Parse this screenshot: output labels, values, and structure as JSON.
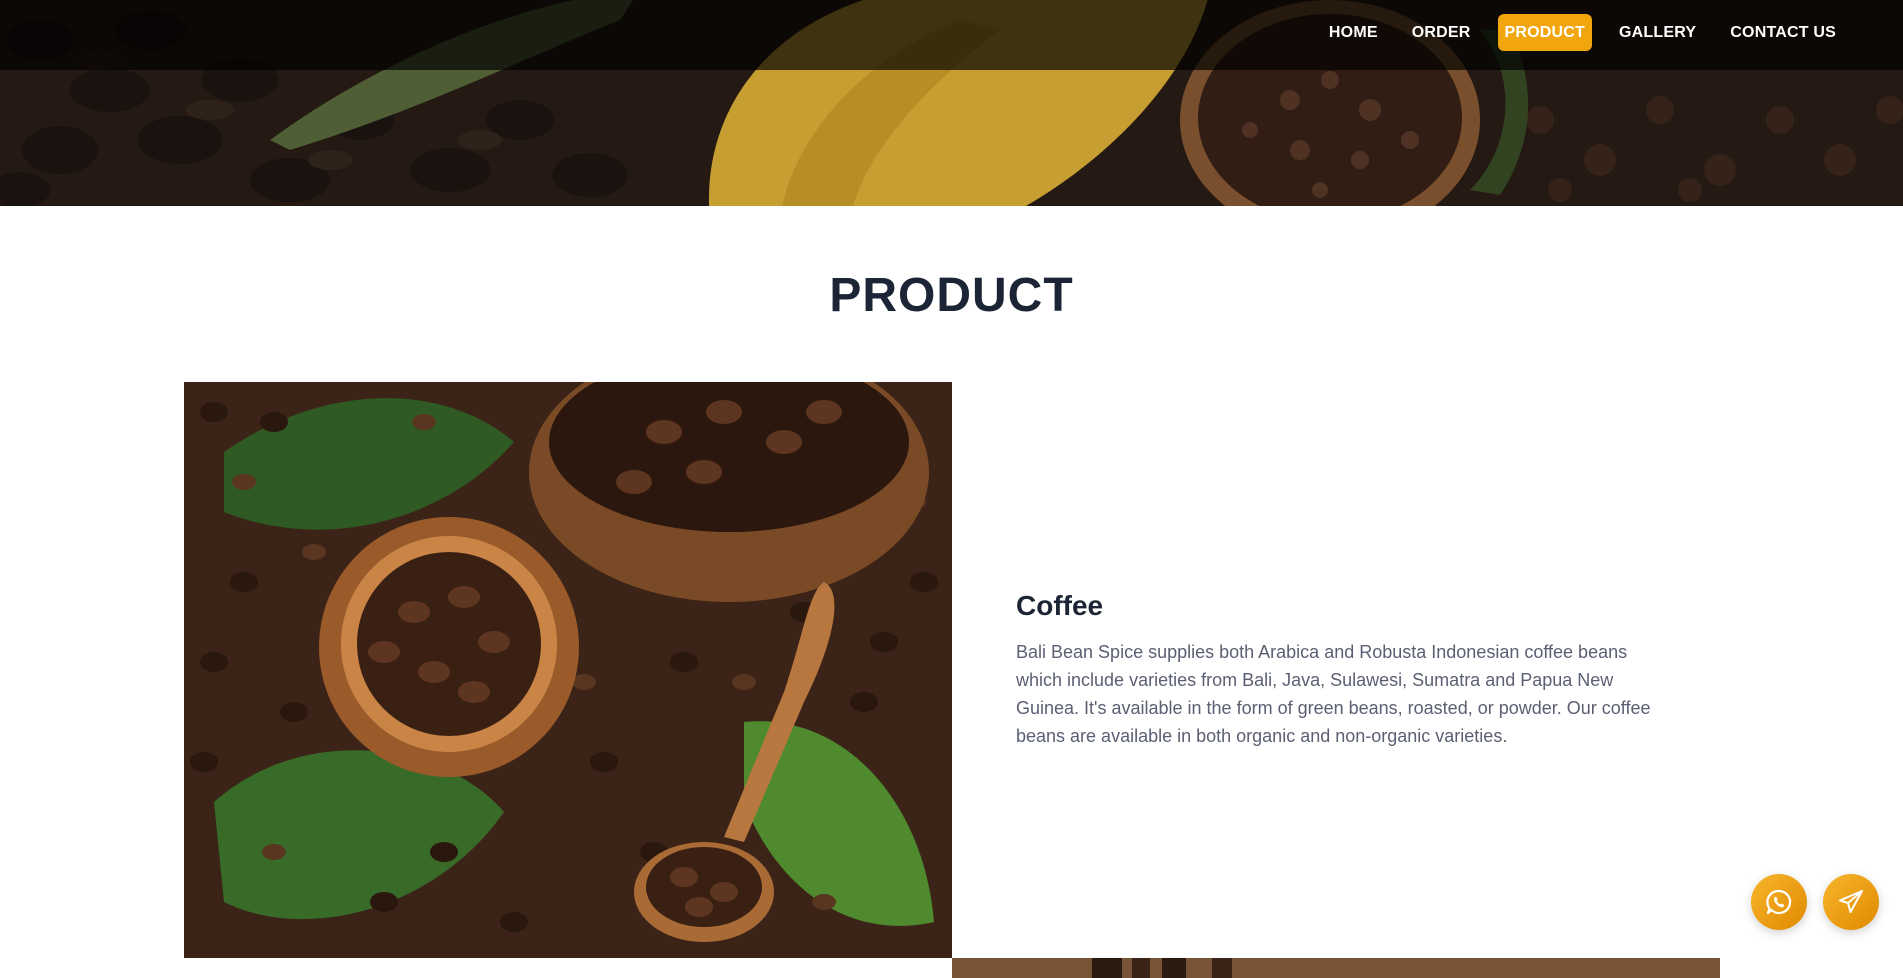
{
  "nav": {
    "items": [
      {
        "label": "HOME",
        "active": false
      },
      {
        "label": "ORDER",
        "active": false
      },
      {
        "label": "PRODUCT",
        "active": true
      },
      {
        "label": "GALLERY",
        "active": false
      },
      {
        "label": "CONTACT US",
        "active": false
      }
    ]
  },
  "section": {
    "title": "PRODUCT"
  },
  "products": [
    {
      "name": "Coffee",
      "description": "Bali Bean Spice supplies both Arabica and Robusta Indonesian coffee beans which include varieties from Bali, Java, Sulawesi, Sumatra and Papua New Guinea. It's available in the form of green beans, roasted, or powder. Our coffee beans are available in both organic and non-organic varieties."
    }
  ],
  "floating": {
    "whatsapp_icon": "whatsapp-icon",
    "send_icon": "paper-plane-icon"
  },
  "colors": {
    "accent": "#f2a60d",
    "heading": "#1c2535",
    "body_text": "#5b5f73"
  }
}
